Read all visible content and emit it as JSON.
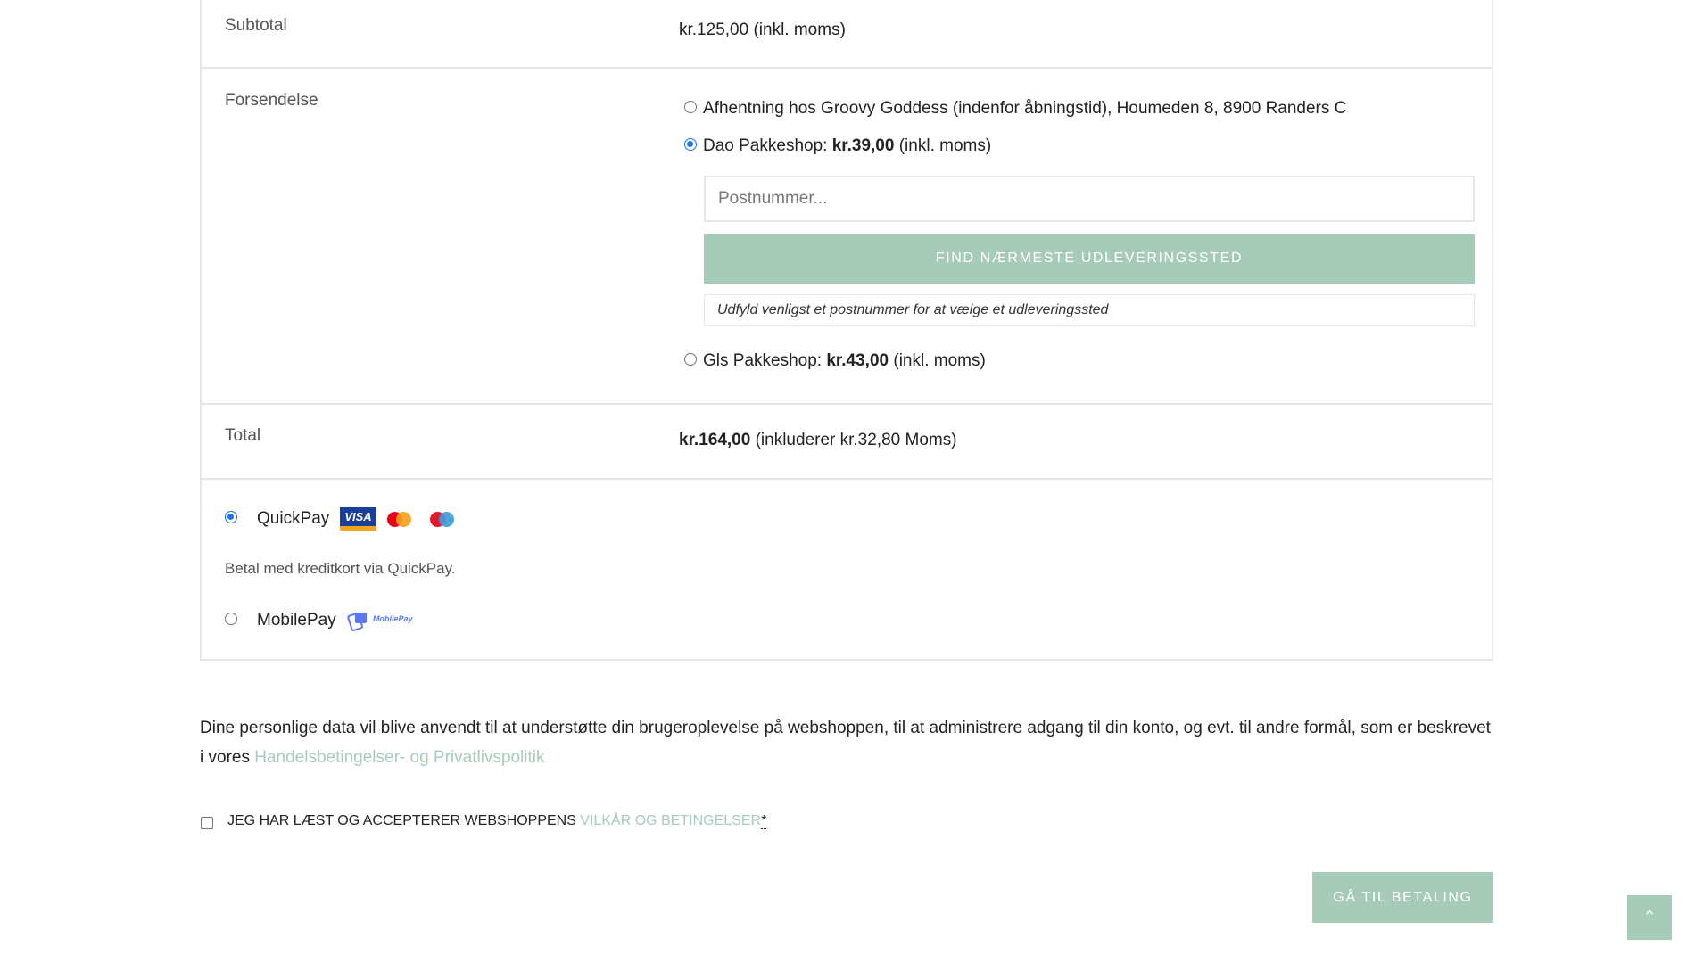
{
  "review": {
    "subtotal": {
      "label": "Subtotal",
      "value": "kr.125,00 (inkl. moms)"
    },
    "shipping": {
      "label": "Forsendelse",
      "options": [
        {
          "text": "Afhentning hos Groovy Goddess (indenfor åbningstid), Houmeden 8, 8900 Randers C",
          "selected": false
        },
        {
          "name": "Dao Pakkeshop: ",
          "price": "kr.39,00",
          "suffix": " (inkl. moms)",
          "selected": true
        },
        {
          "name": "Gls Pakkeshop: ",
          "price": "kr.43,00",
          "suffix": " (inkl. moms)",
          "selected": false
        }
      ],
      "postal_placeholder": "Postnummer...",
      "find_button": "FIND NÆRMESTE UDLEVERINGSSTED",
      "hint": "Udfyld venligst et postnummer for at vælge et udleveringssted"
    },
    "total": {
      "label": "Total",
      "amount": "kr.164,00",
      "tax": " (inkluderer kr.32,80 Moms)"
    }
  },
  "payment": {
    "quickpay": {
      "label": "QuickPay",
      "selected": true,
      "description": "Betal med kreditkort via QuickPay.",
      "visa_text": "VISA"
    },
    "mobilepay": {
      "label": "MobilePay",
      "selected": false,
      "logo_text": "MobilePay"
    }
  },
  "privacy": {
    "text": "Dine personlige data vil blive anvendt til at understøtte din brugeroplevelse på webshoppen, til at administrere adgang til din konto, og evt. til andre formål, som er beskrevet i vores ",
    "link": "Handelsbetingelser- og Privatlivspolitik"
  },
  "terms": {
    "text": "JEG HAR LÆST OG ACCEPTERER WEBSHOPPENS ",
    "link": "VILKÅR OG BETINGELSER",
    "required": "*"
  },
  "pay_button": "GÅ TIL BETALING",
  "back_to_top": "⌃",
  "colors": {
    "accent": "#a7cbb9",
    "radio": "#1a73e8",
    "border": "#e6e6e6"
  }
}
